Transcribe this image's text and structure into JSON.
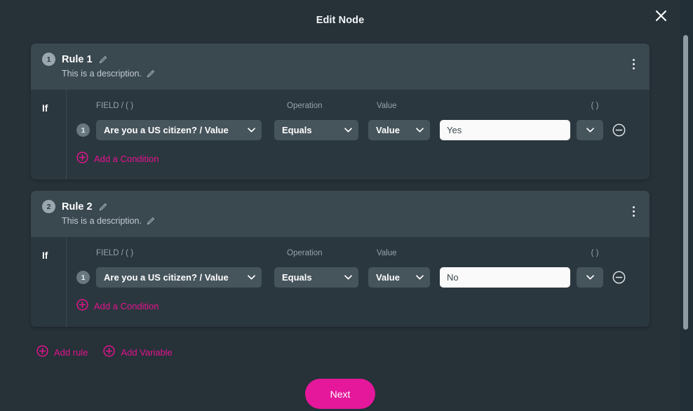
{
  "window": {
    "title": "Edit Node",
    "close_icon": "close-icon"
  },
  "columns": {
    "field": "FIELD / ( )",
    "operation": "Operation",
    "value": "Value",
    "paren": "( )"
  },
  "labels": {
    "if": "If",
    "add_condition": "Add a Condition",
    "add_rule": "Add rule",
    "add_variable": "Add Variable",
    "next": "Next"
  },
  "icons": {
    "pencil": "pencil-icon",
    "kebab": "more-vertical-icon",
    "plus_circle": "plus-circle-icon",
    "minus_circle": "minus-circle-icon",
    "chevron_down": "chevron-down-icon"
  },
  "colors": {
    "accent_pink": "#e3138f",
    "next_button": "#e5179b",
    "panel": "#263138",
    "card_body": "#2b373e",
    "card_header": "#3a4850",
    "control": "#46545c",
    "input_bg": "#fafafa"
  },
  "rules": [
    {
      "number": "1",
      "name": "Rule 1",
      "description": "This is a description.",
      "conditions": [
        {
          "number": "1",
          "field": "Are you a US citizen? / Value",
          "operation": "Equals",
          "value_type": "Value",
          "value": "Yes",
          "paren": ""
        }
      ]
    },
    {
      "number": "2",
      "name": "Rule 2",
      "description": "This is a description.",
      "conditions": [
        {
          "number": "1",
          "field": "Are you a US citizen? / Value",
          "operation": "Equals",
          "value_type": "Value",
          "value": "No",
          "paren": ""
        }
      ]
    }
  ]
}
